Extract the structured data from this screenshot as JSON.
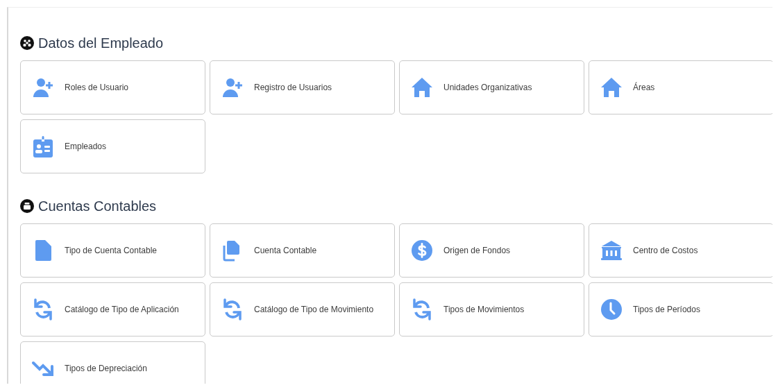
{
  "sections": [
    {
      "title": "Datos del Empleado",
      "kind": "group",
      "cards": [
        {
          "label": "Roles de Usuario",
          "kind": "user-plus"
        },
        {
          "label": "Registro de Usuarios",
          "kind": "user-plus"
        },
        {
          "label": "Unidades Organizativas",
          "kind": "home"
        },
        {
          "label": "Áreas",
          "kind": "home"
        },
        {
          "label": "Empleados",
          "kind": "badge"
        }
      ]
    },
    {
      "title": "Cuentas Contables",
      "kind": "stack",
      "cards": [
        {
          "label": "Tipo de Cuenta Contable",
          "kind": "file"
        },
        {
          "label": "Cuenta Contable",
          "kind": "files"
        },
        {
          "label": "Origen de Fondos",
          "kind": "dollar"
        },
        {
          "label": "Centro de Costos",
          "kind": "bank"
        },
        {
          "label": "Catálogo de Tipo de Aplicación",
          "kind": "refresh"
        },
        {
          "label": "Catálogo de Tipo de Movimiento",
          "kind": "refresh"
        },
        {
          "label": "Tipos de Movimientos",
          "kind": "refresh"
        },
        {
          "label": "Tipos de Períodos",
          "kind": "clock"
        },
        {
          "label": "Tipos de Depreciación",
          "kind": "trend-down"
        }
      ]
    }
  ]
}
